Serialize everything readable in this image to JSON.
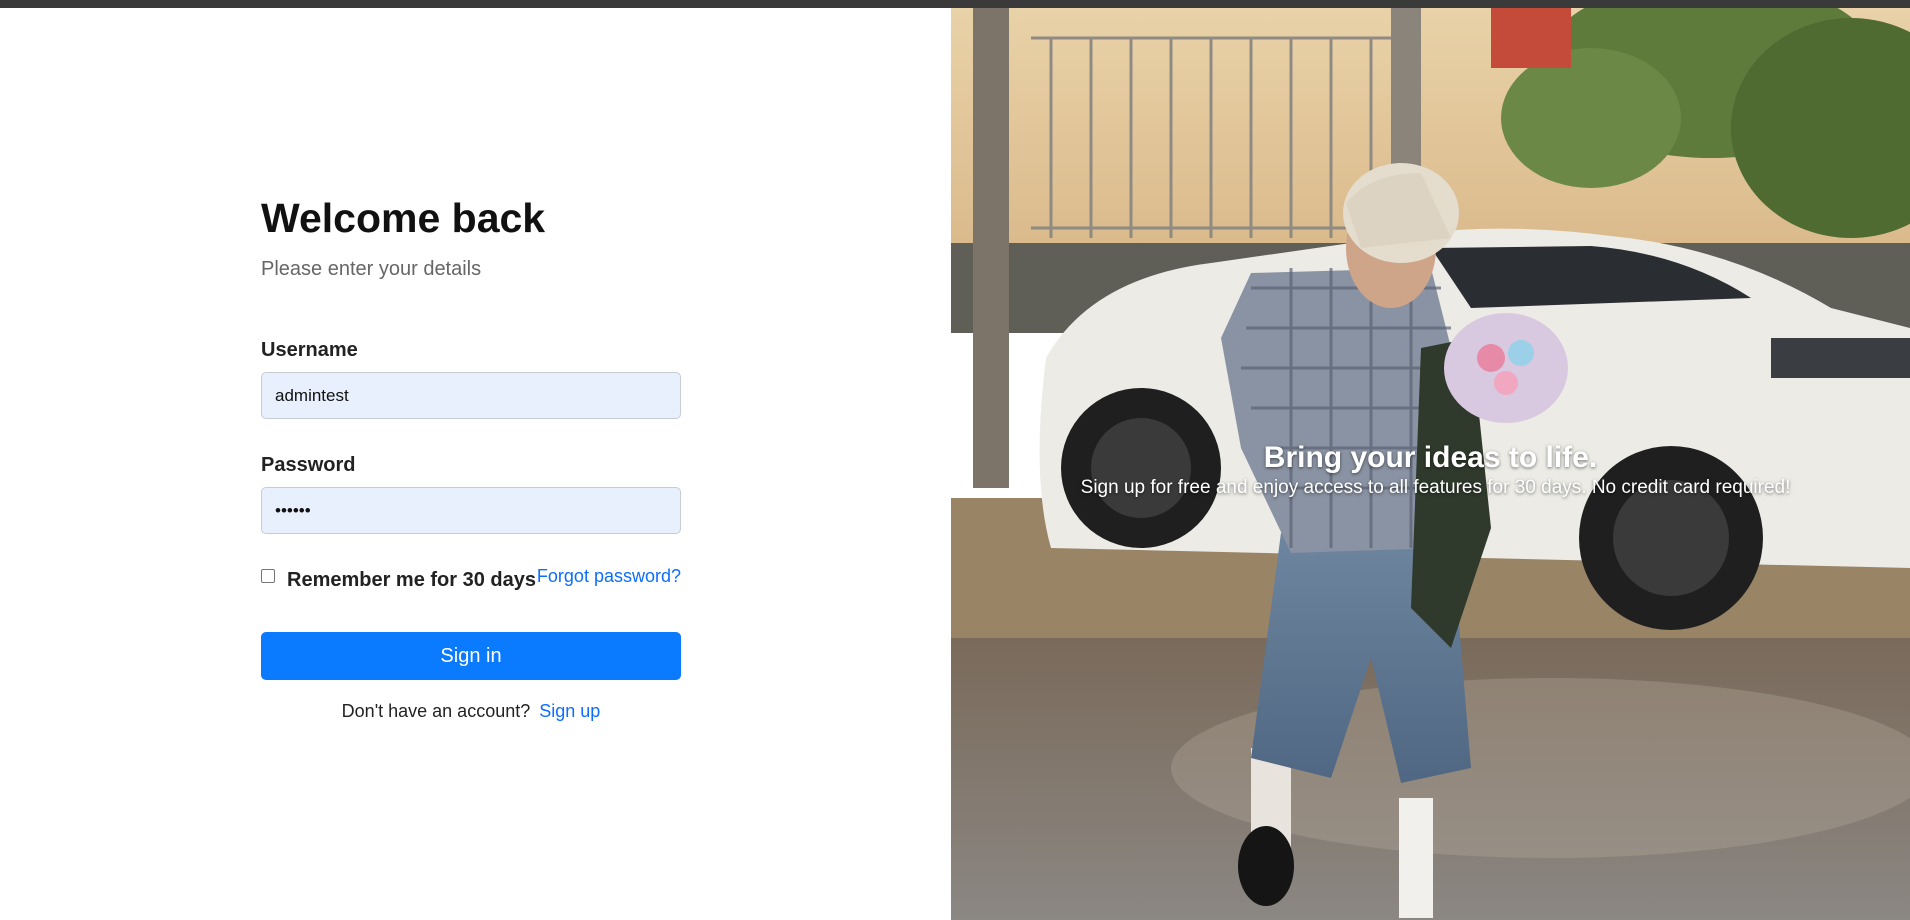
{
  "login": {
    "title": "Welcome back",
    "subtitle": "Please enter your details",
    "username_label": "Username",
    "username_value": "admintest",
    "password_label": "Password",
    "password_value": "••••••",
    "remember_label": "Remember me for 30 days",
    "remember_checked": false,
    "forgot_link": "Forgot password?",
    "signin_label": "Sign in",
    "signup_prompt": "Don't have an account?",
    "signup_link": "Sign up"
  },
  "hero": {
    "title": "Bring your ideas to life.",
    "subtitle": "Sign up for free and enjoy access to all features for 30 days. No credit card required!"
  },
  "colors": {
    "accent": "#0a7bff",
    "link": "#0d6efd",
    "input_bg": "#e8f0fe"
  }
}
